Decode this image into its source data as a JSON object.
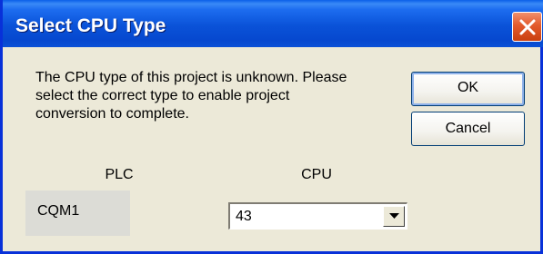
{
  "window": {
    "title": "Select CPU Type",
    "close_icon": "close-x-icon",
    "colors": {
      "titlebar": "#0a52d8",
      "close": "#e35a2c",
      "body": "#ece9d8"
    }
  },
  "message": {
    "lines": [
      "The CPU type of this project is unknown. Please",
      "select the correct type to enable project",
      "conversion to complete."
    ]
  },
  "buttons": {
    "ok": "OK",
    "cancel": "Cancel"
  },
  "plc": {
    "label": "PLC",
    "value": "CQM1"
  },
  "cpu": {
    "label": "CPU",
    "value": "43",
    "dropdown_icon": "chevron-down-icon"
  }
}
